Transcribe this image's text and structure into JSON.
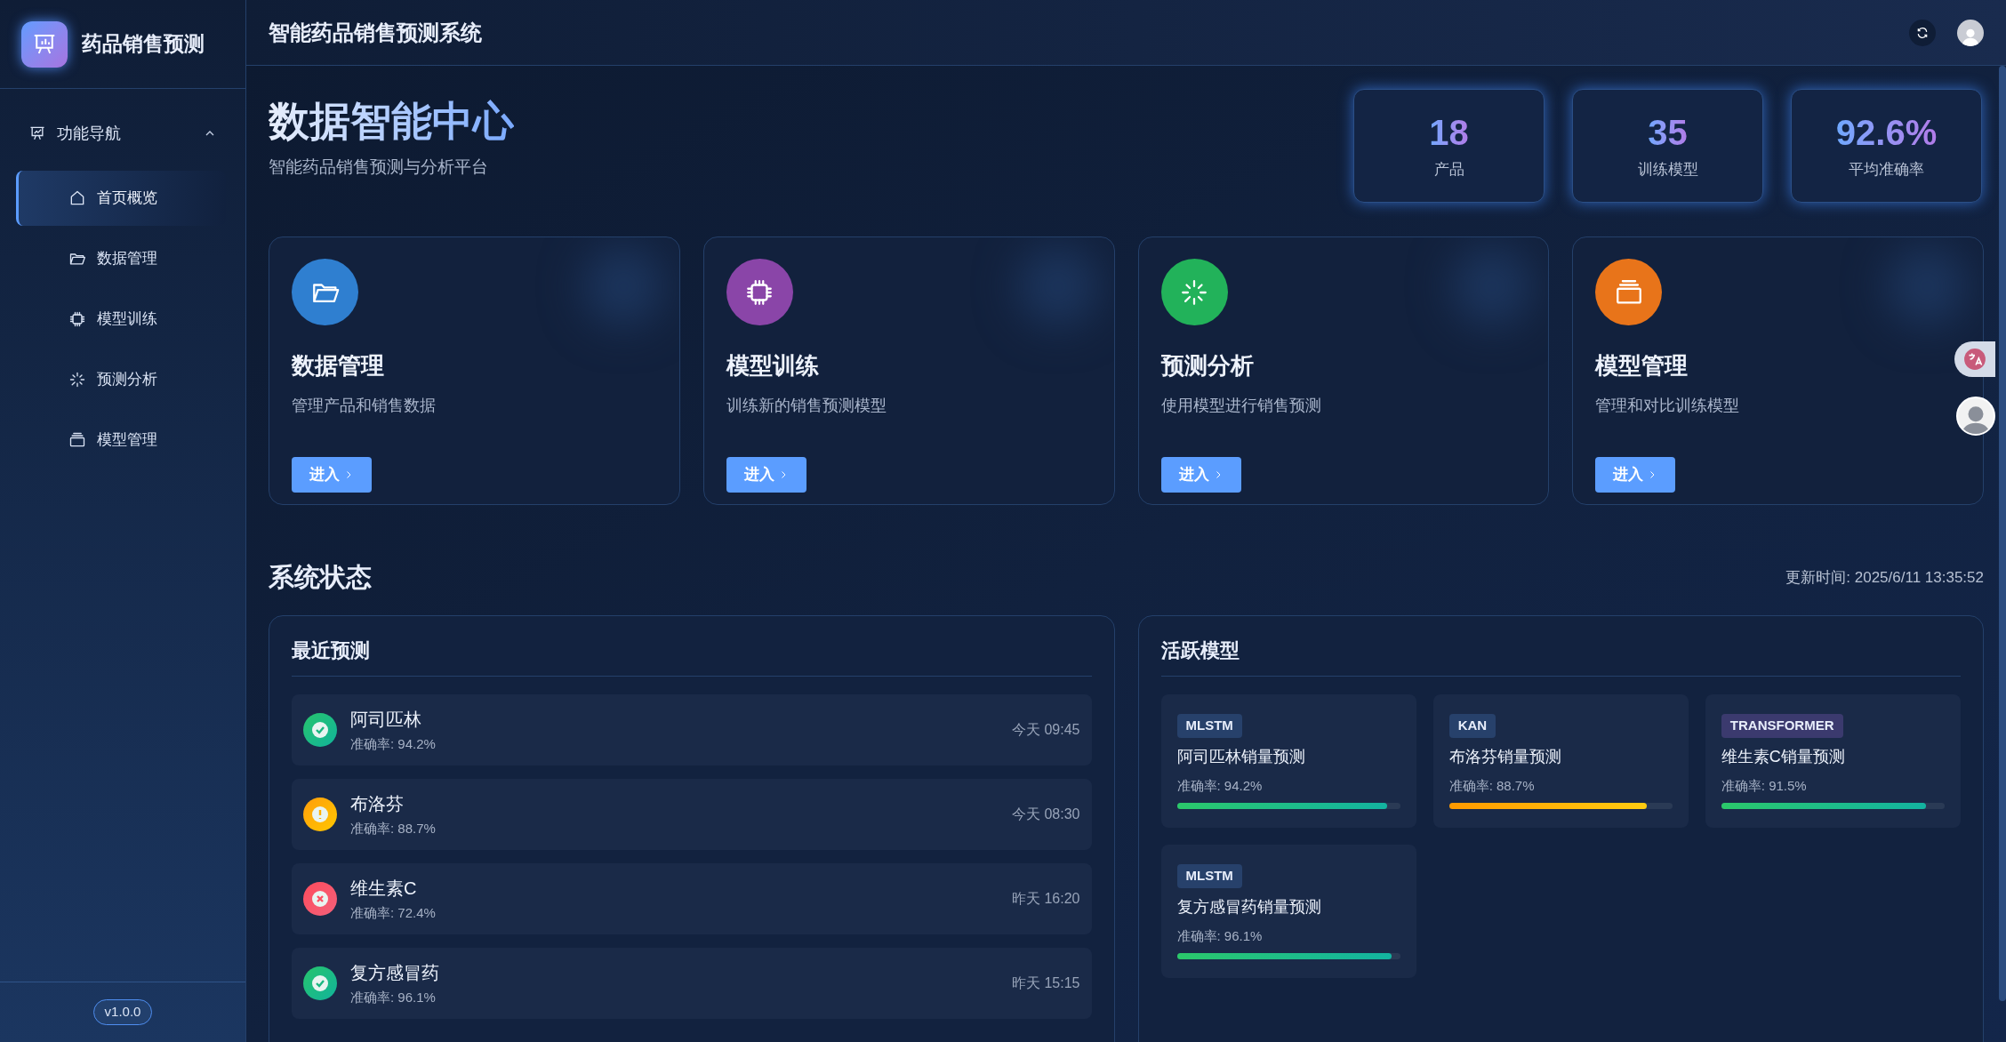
{
  "sidebar": {
    "logo_title": "药品销售预测",
    "nav_group": {
      "label": "功能导航",
      "expanded": true
    },
    "items": [
      {
        "label": "首页概览",
        "kind": "home",
        "selected": true
      },
      {
        "label": "数据管理",
        "kind": "folder",
        "selected": false
      },
      {
        "label": "模型训练",
        "kind": "chip",
        "selected": false
      },
      {
        "label": "预测分析",
        "kind": "spark",
        "selected": false
      },
      {
        "label": "模型管理",
        "kind": "stack",
        "selected": false
      }
    ],
    "version": "v1.0.0"
  },
  "header": {
    "title": "智能药品销售预测系统"
  },
  "hero": {
    "title": "数据智能中心",
    "subtitle": "智能药品销售预测与分析平台",
    "stats": [
      {
        "value": "18",
        "label": "产品"
      },
      {
        "value": "35",
        "label": "训练模型"
      },
      {
        "value": "92.6%",
        "label": "平均准确率"
      }
    ]
  },
  "features": [
    {
      "title": "数据管理",
      "description": "管理产品和销售数据",
      "button": "进入",
      "kind": "folder",
      "color": "#2f7fd0"
    },
    {
      "title": "模型训练",
      "description": "训练新的销售预测模型",
      "button": "进入",
      "kind": "chip",
      "color": "#8a45a8"
    },
    {
      "title": "预测分析",
      "description": "使用模型进行销售预测",
      "button": "进入",
      "kind": "spark",
      "color": "#22b25a"
    },
    {
      "title": "模型管理",
      "description": "管理和对比训练模型",
      "button": "进入",
      "kind": "stack",
      "color": "#e8741a"
    }
  ],
  "status": {
    "title": "系统状态",
    "updated": "更新时间: 2025/6/11 13:35:52"
  },
  "recent": {
    "title": "最近预测",
    "items": [
      {
        "name": "阿司匹林",
        "accuracy": "准确率: 94.2%",
        "time": "今天 09:45",
        "kind": "success"
      },
      {
        "name": "布洛芬",
        "accuracy": "准确率: 88.7%",
        "time": "今天 08:30",
        "kind": "warning"
      },
      {
        "name": "维生素C",
        "accuracy": "准确率: 72.4%",
        "time": "昨天 16:20",
        "kind": "error"
      },
      {
        "name": "复方感冒药",
        "accuracy": "准确率: 96.1%",
        "time": "昨天 15:15",
        "kind": "success"
      }
    ]
  },
  "models": {
    "title": "活跃模型",
    "items": [
      {
        "tag": "MLSTM",
        "color": "#27416b",
        "name": "阿司匹林销量预测",
        "accuracy": "准确率: 94.2%",
        "level": 0.942,
        "kind": "good"
      },
      {
        "tag": "KAN",
        "color": "#27416b",
        "name": "布洛芬销量预测",
        "accuracy": "准确率: 88.7%",
        "level": 0.887,
        "kind": "warning"
      },
      {
        "tag": "TRANSFORMER",
        "color": "#3b3a6e",
        "name": "维生素C销量预测",
        "accuracy": "准确率: 91.5%",
        "level": 0.915,
        "kind": "good"
      },
      {
        "tag": "MLSTM",
        "color": "#27416b",
        "name": "复方感冒药销量预测",
        "accuracy": "准确率: 96.1%",
        "level": 0.961,
        "kind": "good"
      }
    ]
  }
}
